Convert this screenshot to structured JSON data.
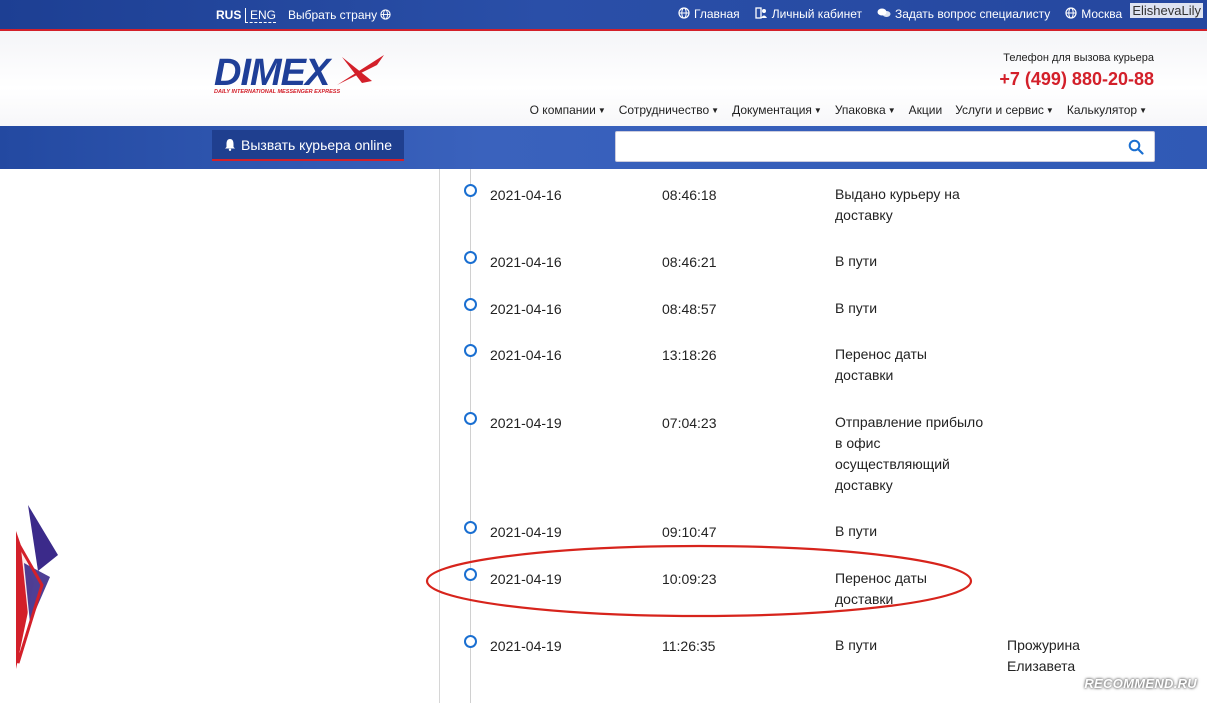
{
  "topbar": {
    "lang_rus": "RUS",
    "lang_eng": "ENG",
    "choose_country": "Выбрать страну",
    "links": [
      {
        "label": "Главная",
        "icon": "globe-icon"
      },
      {
        "label": "Личный кабинет",
        "icon": "user-cabinet-icon"
      },
      {
        "label": "Задать вопрос специалисту",
        "icon": "chat-icon"
      },
      {
        "label": "Москва",
        "icon": "globe-icon"
      }
    ],
    "username_watermark": "ElishevaLily"
  },
  "header": {
    "logo_text": "DIMEX",
    "logo_subtitle": "DAILY INTERNATIONAL MESSENGER EXPRESS",
    "phone_label": "Телефон для вызова курьера",
    "phone": "+7 (499) 880-20-88",
    "menu": [
      "О компании",
      "Сотрудничество",
      "Документация",
      "Упаковка",
      "Акции",
      "Услуги и сервис",
      "Калькулятор"
    ],
    "menu_has_caret": [
      true,
      true,
      true,
      true,
      false,
      true,
      true
    ]
  },
  "actionbar": {
    "call_courier_label": "Вызвать курьера online",
    "search_placeholder": "",
    "search_value": ""
  },
  "tracking": [
    {
      "date": "2021-04-16",
      "time": "08:46:18",
      "status": "Выдано курьеру на доставку",
      "person": ""
    },
    {
      "date": "2021-04-16",
      "time": "08:46:21",
      "status": "В пути",
      "person": ""
    },
    {
      "date": "2021-04-16",
      "time": "08:48:57",
      "status": "В пути",
      "person": ""
    },
    {
      "date": "2021-04-16",
      "time": "13:18:26",
      "status": "Перенос даты доставки",
      "person": ""
    },
    {
      "date": "2021-04-19",
      "time": "07:04:23",
      "status": "Отправление прибыло в офис осуществляющий доставку",
      "person": ""
    },
    {
      "date": "2021-04-19",
      "time": "09:10:47",
      "status": "В пути",
      "person": ""
    },
    {
      "date": "2021-04-19",
      "time": "10:09:23",
      "status": "Перенос даты доставки",
      "person": ""
    },
    {
      "date": "2021-04-19",
      "time": "11:26:35",
      "status": "В пути",
      "person": "Прожурина Елизавета"
    }
  ],
  "highlighted_row": 6,
  "colors": {
    "brand_blue": "#1d3f93",
    "accent_red": "#d3202a",
    "timeline_dot": "#1a6fd1"
  },
  "watermark": "RECOMMEND.RU"
}
